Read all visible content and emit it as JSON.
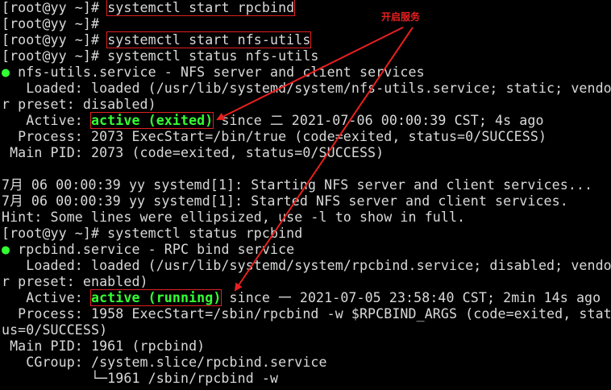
{
  "annotation": {
    "label": "开启服务",
    "color": "#e82020"
  },
  "terminal": {
    "lines": [
      {
        "parts": [
          {
            "t": "[root@yy ~]# "
          },
          {
            "t": "systemctl start rpcbind",
            "cls": "boxed"
          }
        ]
      },
      {
        "parts": [
          {
            "t": "[root@yy ~]# "
          }
        ]
      },
      {
        "parts": [
          {
            "t": "[root@yy ~]# "
          },
          {
            "t": "systemctl start nfs-utils",
            "cls": "boxed"
          }
        ]
      },
      {
        "parts": [
          {
            "t": "[root@yy ~]# systemctl status nfs-utils"
          }
        ]
      },
      {
        "parts": [
          {
            "t": "●",
            "cls": "dot"
          },
          {
            "t": " nfs-utils.service - NFS server and client services"
          }
        ]
      },
      {
        "parts": [
          {
            "t": "   Loaded: loaded (/usr/lib/systemd/system/nfs-utils.service; static; vendo"
          }
        ]
      },
      {
        "parts": [
          {
            "t": "r preset: disabled)"
          }
        ]
      },
      {
        "parts": [
          {
            "t": "   Active: "
          },
          {
            "t": "active (exited)",
            "cls": "green-bold boxed"
          },
          {
            "t": " since 二 2021-07-06 00:00:39 CST; 4s ago"
          }
        ]
      },
      {
        "parts": [
          {
            "t": "  Process: 2073 ExecStart=/bin/true (code=exited, status=0/SUCCESS)"
          }
        ]
      },
      {
        "parts": [
          {
            "t": " Main PID: 2073 (code=exited, status=0/SUCCESS)"
          }
        ]
      },
      {
        "parts": [
          {
            "t": ""
          }
        ]
      },
      {
        "parts": [
          {
            "t": "7月 06 00:00:39 yy systemd[1]: Starting NFS server and client services..."
          }
        ]
      },
      {
        "parts": [
          {
            "t": "7月 06 00:00:39 yy systemd[1]: Started NFS server and client services."
          }
        ]
      },
      {
        "parts": [
          {
            "t": "Hint: Some lines were ellipsized, use -l to show in full."
          }
        ]
      },
      {
        "parts": [
          {
            "t": "[root@yy ~]# systemctl status rpcbind"
          }
        ]
      },
      {
        "parts": [
          {
            "t": "●",
            "cls": "dot"
          },
          {
            "t": " rpcbind.service - RPC bind service"
          }
        ]
      },
      {
        "parts": [
          {
            "t": "   Loaded: loaded (/usr/lib/systemd/system/rpcbind.service; disabled; vendo"
          }
        ]
      },
      {
        "parts": [
          {
            "t": "r preset: enabled)"
          }
        ]
      },
      {
        "parts": [
          {
            "t": "   Active: "
          },
          {
            "t": "active (running)",
            "cls": "green-bold boxed"
          },
          {
            "t": " since 一 2021-07-05 23:58:40 CST; 2min 14s ago"
          }
        ]
      },
      {
        "parts": [
          {
            "t": "  Process: 1958 ExecStart=/sbin/rpcbind -w $RPCBIND_ARGS (code=exited, stat"
          }
        ]
      },
      {
        "parts": [
          {
            "t": "us=0/SUCCESS)"
          }
        ]
      },
      {
        "parts": [
          {
            "t": " Main PID: 1961 (rpcbind)"
          }
        ]
      },
      {
        "parts": [
          {
            "t": "   CGroup: /system.slice/rpcbind.service"
          }
        ]
      },
      {
        "parts": [
          {
            "t": "           └─1961 /sbin/rpcbind -w"
          }
        ]
      }
    ]
  }
}
